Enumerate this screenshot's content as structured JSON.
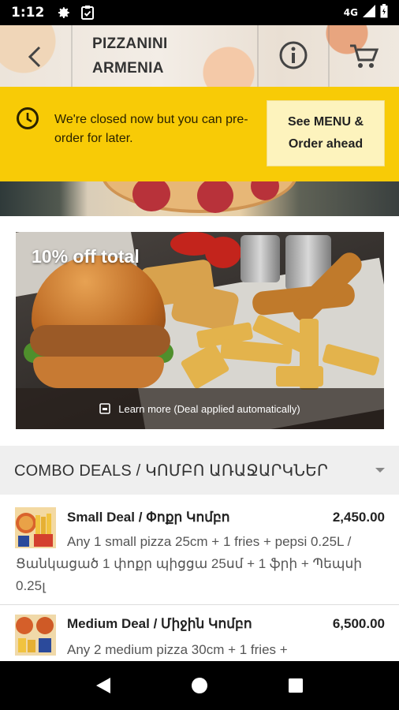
{
  "status_bar": {
    "time": "1:12",
    "network": "4G"
  },
  "header": {
    "title_line1": "PIZZANINI",
    "title_line2": "ARMENIA",
    "back_icon": "chevron-left-icon",
    "info_icon": "info-icon",
    "cart_icon": "cart-icon"
  },
  "closed_banner": {
    "message": "We're closed now but you can pre-order for later.",
    "button_line1": "See MENU &",
    "button_line2": "Order ahead",
    "color": "#f8cb06"
  },
  "promo": {
    "title": "10% off total",
    "footer": "Learn more (Deal applied automatically)"
  },
  "category": {
    "title": "COMBO DEALS / ԿՈՄԲՈ ԱՌԱՋԱՐԿՆԵՐ"
  },
  "menu_items": [
    {
      "name": "Small Deal / Փոքր Կոմբո",
      "price": "2,450.00",
      "description": "Any 1 small pizza 25cm + 1 fries + pepsi 0.25L / Ցանկացած 1 փոքր պիցցա 25սմ + 1 ֆրի + Պեպսի 0.25լ"
    },
    {
      "name": "Medium Deal / Միջին Կոմբո",
      "price": "6,500.00",
      "description": "Any 2 medium pizza 30cm + 1 fries +"
    }
  ]
}
